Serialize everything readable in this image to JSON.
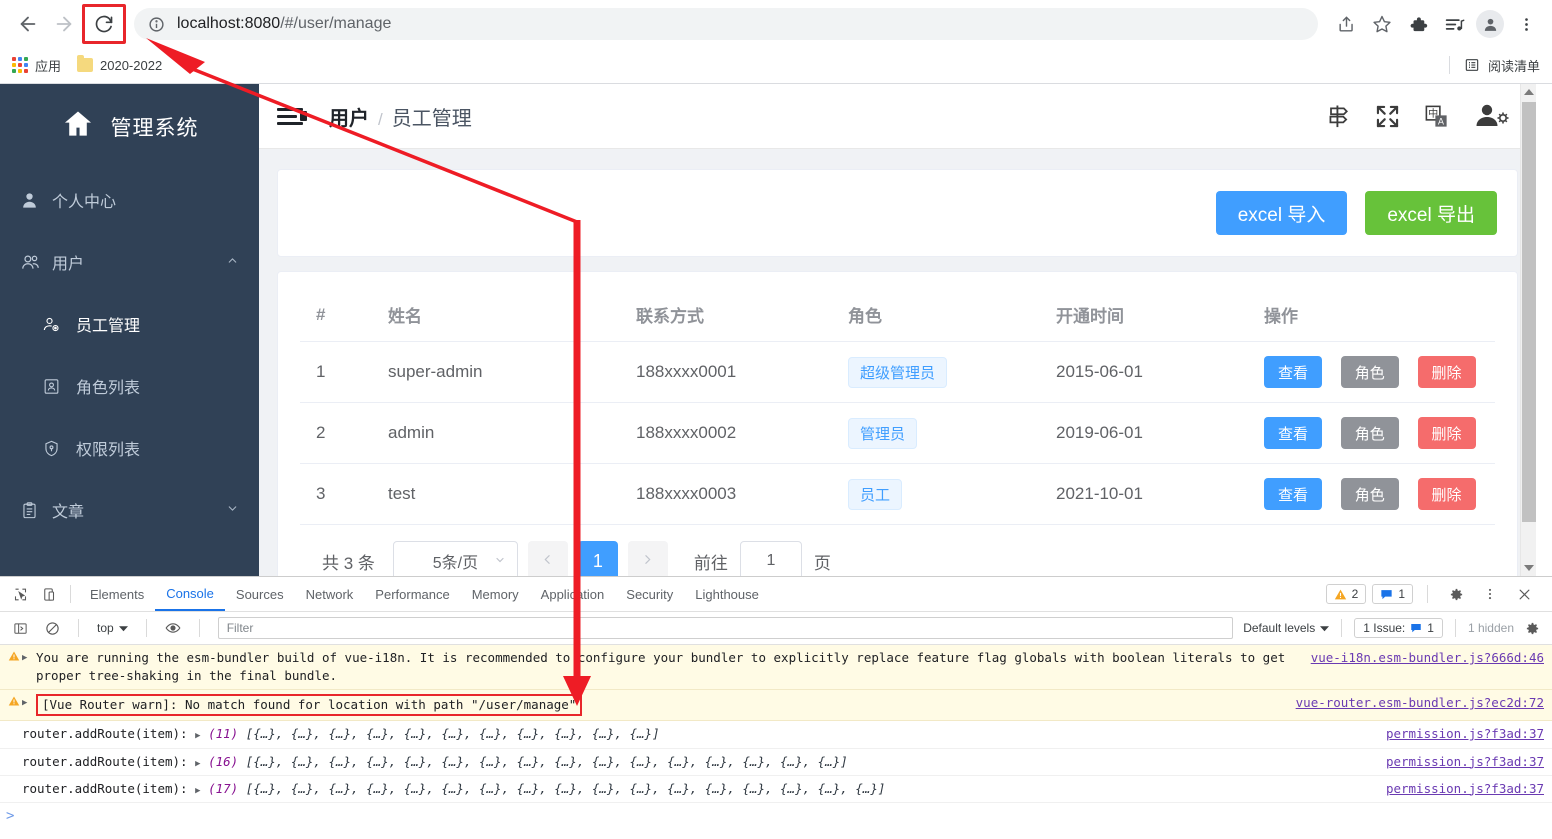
{
  "browser": {
    "url_host": "localhost:8080",
    "url_path": "/#/user/manage",
    "url_full": "localhost:8080/#/user/manage",
    "back_icon": "back-arrow-icon",
    "forward_icon": "forward-arrow-icon",
    "reload_icon": "reload-icon",
    "info_icon": "site-info-icon",
    "toolbar_icons": [
      "share-icon",
      "bookmark-star-icon",
      "extensions-puzzle-icon",
      "media-list-icon",
      "profile-avatar-icon",
      "chrome-menu-icon"
    ],
    "bookmarks": [
      {
        "label": "应用",
        "icon": "apps-grid-icon"
      },
      {
        "label": "2020-2022",
        "icon": "folder-icon"
      }
    ],
    "reading_list": {
      "label": "阅读清单",
      "icon": "reading-list-icon"
    }
  },
  "sidebar": {
    "brand": "管理系统",
    "brand_icon": "home-icon",
    "items": [
      {
        "label": "个人中心",
        "icon": "user-icon",
        "arrow": "",
        "active": false
      },
      {
        "label": "用户",
        "icon": "users-group-icon",
        "arrow": "⌃",
        "active": false
      }
    ],
    "sub_items": [
      {
        "label": "员工管理",
        "icon": "user-gear-icon",
        "active": true
      },
      {
        "label": "角色列表",
        "icon": "id-card-icon",
        "active": false
      },
      {
        "label": "权限列表",
        "icon": "shield-key-icon",
        "active": false
      }
    ],
    "items_after": [
      {
        "label": "文章",
        "icon": "clipboard-icon",
        "arrow": "⌄",
        "active": false
      }
    ]
  },
  "header": {
    "collapse_icon": "hamburger-collapse-icon",
    "breadcrumb_parent": "用户",
    "breadcrumb_sep": "/",
    "breadcrumb_current": "员工管理",
    "icons": [
      "guide-signpost-icon",
      "fullscreen-expand-icon",
      "language-switch-icon",
      "user-settings-icon"
    ]
  },
  "toolbar": {
    "import_label": "excel 导入",
    "export_label": "excel 导出",
    "import_color": "#409eff",
    "export_color": "#67c23a"
  },
  "table": {
    "columns": [
      "#",
      "姓名",
      "联系方式",
      "角色",
      "开通时间",
      "操作"
    ],
    "rows": [
      {
        "idx": "1",
        "name": "super-admin",
        "phone": "188xxxx0001",
        "role": "超级管理员",
        "time": "2015-06-01"
      },
      {
        "idx": "2",
        "name": "admin",
        "phone": "188xxxx0002",
        "role": "管理员",
        "time": "2019-06-01"
      },
      {
        "idx": "3",
        "name": "test",
        "phone": "188xxxx0003",
        "role": "员工",
        "time": "2021-10-01"
      }
    ],
    "actions": [
      {
        "label": "查看",
        "color": "#409eff"
      },
      {
        "label": "角色",
        "color": "#909399"
      },
      {
        "label": "删除",
        "color": "#f56c6c"
      }
    ]
  },
  "pagination": {
    "total_text": "共 3 条",
    "page_size": "5条/页",
    "prev_icon": "chevron-left-icon",
    "next_icon": "chevron-right-icon",
    "current_page": "1",
    "jump_label": "前往",
    "jump_value": "1",
    "jump_unit": "页"
  },
  "devtools": {
    "tool_icons": [
      "inspect-element-icon",
      "device-toolbar-icon"
    ],
    "tabs": [
      "Elements",
      "Console",
      "Sources",
      "Network",
      "Performance",
      "Memory",
      "Application",
      "Security",
      "Lighthouse"
    ],
    "active_tab": "Console",
    "warning_count": "2",
    "message_count": "1",
    "settings_icon": "gear-icon",
    "more_icon": "kebab-menu-icon",
    "close_icon": "close-icon",
    "console_bar": {
      "sidebar_icon": "console-sidebar-icon",
      "clear_icon": "clear-console-icon",
      "context": "top",
      "eye_icon": "live-expression-eye-icon",
      "filter_placeholder": "Filter",
      "levels": "Default levels",
      "issues_label": "1 Issue:",
      "issues_count": "1",
      "hidden": "1 hidden",
      "settings_icon": "console-settings-gear-icon"
    },
    "logs": [
      {
        "type": "warning",
        "text": "You are running the esm-bundler build of vue-i18n. It is recommended to configure your bundler to explicitly replace feature flag globals with boolean literals to get proper tree-shaking in the final bundle.",
        "source": "vue-i18n.esm-bundler.js?666d:46",
        "boxed": false
      },
      {
        "type": "warning",
        "text": "[Vue Router warn]: No match found for location with path \"/user/manage\"",
        "source": "vue-router.esm-bundler.js?ec2d:72",
        "boxed": true
      },
      {
        "type": "log",
        "label": "router.addRoute(item):",
        "count": "(11)",
        "preview": "[{…}, {…}, {…}, {…}, {…}, {…}, {…}, {…}, {…}, {…}, {…}]",
        "source": "permission.js?f3ad:37"
      },
      {
        "type": "log",
        "label": "router.addRoute(item):",
        "count": "(16)",
        "preview": "[{…}, {…}, {…}, {…}, {…}, {…}, {…}, {…}, {…}, {…}, {…}, {…}, {…}, {…}, {…}, {…}]",
        "source": "permission.js?f3ad:37"
      },
      {
        "type": "log",
        "label": "router.addRoute(item):",
        "count": "(17)",
        "preview": "[{…}, {…}, {…}, {…}, {…}, {…}, {…}, {…}, {…}, {…}, {…}, {…}, {…}, {…}, {…}, {…}, {…}]",
        "source": "permission.js?f3ad:37"
      }
    ],
    "prompt": ">"
  },
  "annotation": {
    "color": "#ee1c25"
  }
}
